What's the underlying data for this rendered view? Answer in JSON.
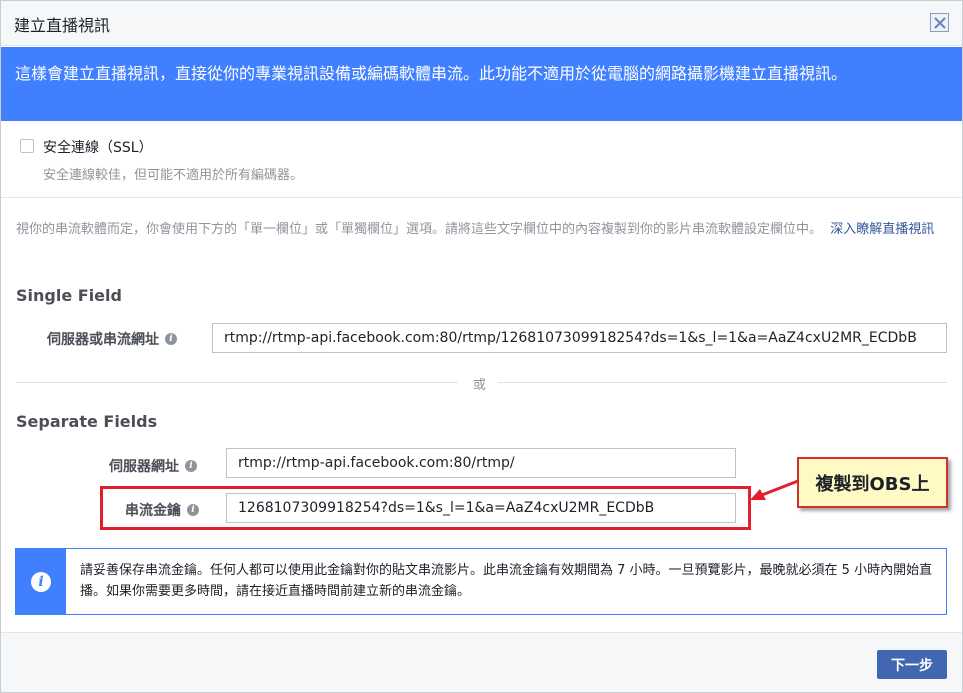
{
  "dialog": {
    "title": "建立直播視訊"
  },
  "banner": {
    "text": "這樣會建立直播視訊，直接從你的專業視訊設備或編碼軟體串流。此功能不適用於從電腦的網路攝影機建立直播視訊。"
  },
  "ssl": {
    "label": "安全連線（SSL）",
    "description": "安全連線較佳，但可能不適用於所有編碼器。",
    "checked": false
  },
  "instructions": {
    "text": "視你的串流軟體而定，你會使用下方的「單一欄位」或「單獨欄位」選項。請將這些文字欄位中的內容複製到你的影片串流軟體設定欄位中。",
    "link": "深入瞭解直播視訊"
  },
  "single_field": {
    "heading": "Single Field",
    "label": "伺服器或串流網址",
    "value": "rtmp://rtmp-api.facebook.com:80/rtmp/1268107309918254?ds=1&s_l=1&a=AaZ4cxU2MR_ECDbB"
  },
  "or_text": "或",
  "separate_fields": {
    "heading": "Separate Fields",
    "server_label": "伺服器網址",
    "server_value": "rtmp://rtmp-api.facebook.com:80/rtmp/",
    "key_label": "串流金鑰",
    "key_value": "1268107309918254?ds=1&s_l=1&a=AaZ4cxU2MR_ECDbB"
  },
  "annotation": {
    "text": "複製到OBS上",
    "color": "#e0202c"
  },
  "notice": {
    "text": "請妥善保存串流金鑰。任何人都可以使用此金鑰對你的貼文串流影片。此串流金鑰有效期間為 7 小時。一旦預覽影片，最晚就必須在 5 小時內開始直播。如果你需要更多時間，請在接近直播時間前建立新的串流金鑰。"
  },
  "footer": {
    "next_label": "下一步"
  },
  "colors": {
    "accent": "#4080ff",
    "button": "#4267b2",
    "link": "#365899"
  }
}
